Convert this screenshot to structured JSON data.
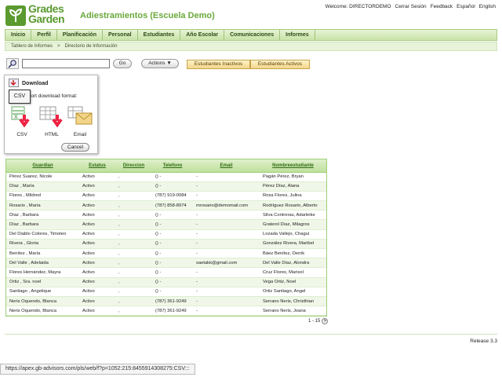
{
  "header": {
    "logo_line1": "Grades",
    "logo_line2": "Garden",
    "title": "Adiestramientos (Escuela Demo)",
    "links": [
      "Welcome: DIRECTORDEMO",
      "Cerrar Sesión",
      "Feedback",
      "Español",
      "English"
    ]
  },
  "nav": {
    "items": [
      "Inicio",
      "Perfil",
      "Planificación",
      "Personal",
      "Estudiantes",
      "Año Escolar",
      "Comunicaciones",
      "Informes"
    ]
  },
  "breadcrumb": {
    "items": [
      "Tablero de Informes",
      ">",
      "Directorio de Información"
    ]
  },
  "toolbar": {
    "search_value": "",
    "go_label": "Go",
    "actions_label": "Actions",
    "tab_inactive": "Estudiantes Inactivos",
    "tab_active": "Estudiantes Activos"
  },
  "download_dialog": {
    "title": "Download",
    "prompt": "report download format:",
    "tooltip": "CSV",
    "formats": [
      "CSV",
      "HTML",
      "Email"
    ],
    "cancel_label": "Cancel"
  },
  "table": {
    "columns": [
      "Guardian",
      "Estatus",
      "Direccion",
      "Telefono",
      "Email",
      "Nombreestudiante"
    ],
    "rows": [
      [
        "Pérez Suarez, Nicole",
        "Activo",
        ",",
        "() -",
        "-",
        "Pagán Pérez, Bryan"
      ],
      [
        "Díaz , María",
        "Activo",
        ",",
        "() -",
        "-",
        "Pérez Díaz, Alana"
      ],
      [
        "Flores , Mildred",
        "Activo",
        ",",
        "(787) 919-0084",
        "-",
        "Rosa Flores, Julina"
      ],
      [
        "Rosario , María",
        "Activo",
        ",",
        "(787) 858-8974",
        "mrosario@demomail.com",
        "Rodríguez Rosario, Alberto"
      ],
      [
        "Díaz , Barbara",
        "Activo",
        ",",
        "() -",
        "-",
        "Silva Contreras, Adarleike"
      ],
      [
        "Díaz , Barbara",
        "Activo",
        ",",
        "() -",
        "-",
        "Graterol Díaz, Milagros"
      ],
      [
        "Del Diablo Colores, Timoteo",
        "Activo",
        ",",
        "() -",
        "-",
        "Lozada Vallejo, Chagui"
      ],
      [
        "Rivera , Gloria",
        "Activo",
        ",",
        "() -",
        "-",
        "González Rivera, Maribel"
      ],
      [
        "Benítez , María",
        "Activo",
        ",",
        "() -",
        "-",
        "Báez Benítez, Derrik"
      ],
      [
        "Del Valle , Adelaida",
        "Activo",
        ",",
        "() -",
        "saetakk@gmail.com",
        "Del Valle Díaz, Alondra"
      ],
      [
        "Flores Hernández, Mayra",
        "Activo",
        ",",
        "() -",
        "-",
        "Cruz Flores, Marisol"
      ],
      [
        "Ortiz , Sra. noel",
        "Activo",
        ",",
        "() -",
        "-",
        "Vega Ortiz, Noel"
      ],
      [
        "Santiago , Angelique",
        "Activo",
        ",",
        "() -",
        "-",
        "Ortiz Santiago, Angel"
      ],
      [
        "Neris Oquendo, Blanca",
        "Activo",
        ",",
        "(787) 361-9249",
        "-",
        "Serrano Neris, Christhian"
      ],
      [
        "Neris Oquendo, Blanca",
        "Activo",
        ",",
        "(787) 361-9249",
        "-",
        "Serrano Neris, Joana"
      ]
    ],
    "pager": "1 - 15",
    "pager_next": ">"
  },
  "footer": {
    "release": "Release 3.3"
  },
  "status_url": "https://apex.gb-advisors.com/pls/web/f?p=1052:215:8455914308275:CSV:::",
  "colors": {
    "brand_green": "#5a9a2f",
    "header_title": "#6aa83b",
    "nav_bg": "#c9e3a8",
    "tab_gold": "#f2d68a"
  }
}
